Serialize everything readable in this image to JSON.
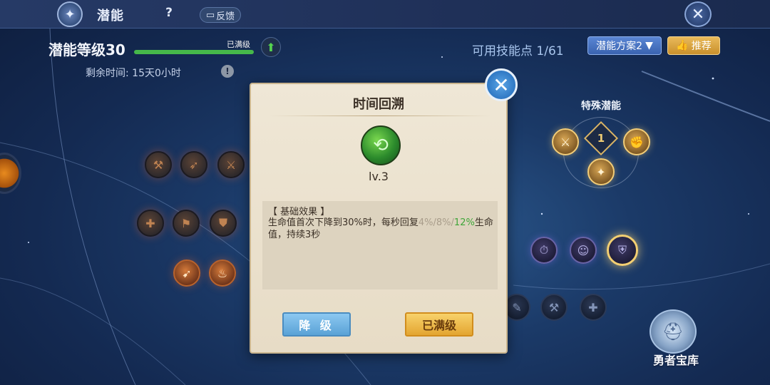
{
  "header": {
    "title": "潜能",
    "help": "?",
    "feedback": "反馈",
    "close": "✕"
  },
  "level": {
    "label": "潜能等级30",
    "status": "已满级",
    "progress": 1.0,
    "remaining": "剩余时间: 15天0小时"
  },
  "points": "可用技能点 1/61",
  "plan_button": "潜能方案2",
  "recommend_button": "推荐",
  "special_label": "特殊潜能",
  "special_badge": "1",
  "vault_label": "勇者宝库",
  "modal": {
    "title": "时间回溯",
    "level": "lv.3",
    "effect_title": "【 基础效果 】",
    "effect_main": "生命值首次下降到30%时，每秒回复",
    "effect_dim": "4%/8%/",
    "effect_green": "12%",
    "effect_end": "生命值，持续3秒",
    "downgrade": "降 级",
    "maxed": "已满级"
  },
  "colors": {
    "progress": "#46b84a",
    "accent_blue": "#5ca6e6",
    "accent_gold": "#e3a531"
  }
}
